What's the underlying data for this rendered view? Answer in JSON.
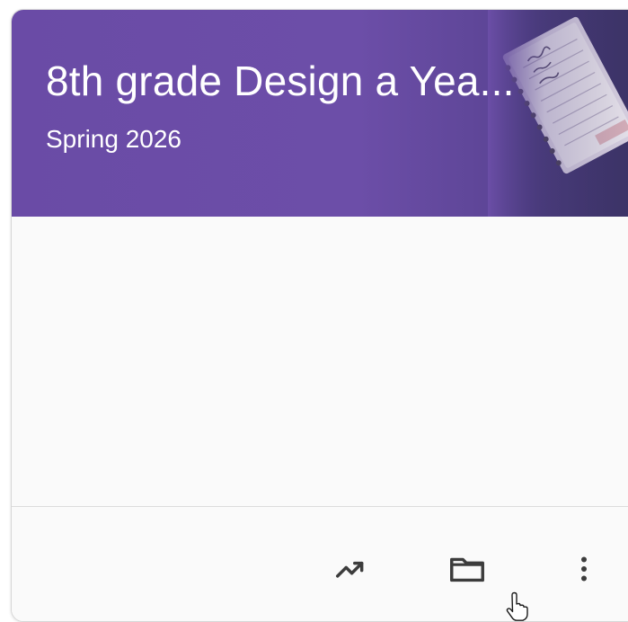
{
  "card": {
    "title": "8th grade Design a Yea...",
    "subtitle": "Spring 2026"
  },
  "footer": {
    "icons": [
      "trending-up-icon",
      "folder-icon",
      "more-vert-icon"
    ]
  },
  "colors": {
    "header_bg": "#6a4ba6",
    "text_on_header": "#ffffff",
    "icon_color": "#3c3c3c"
  }
}
